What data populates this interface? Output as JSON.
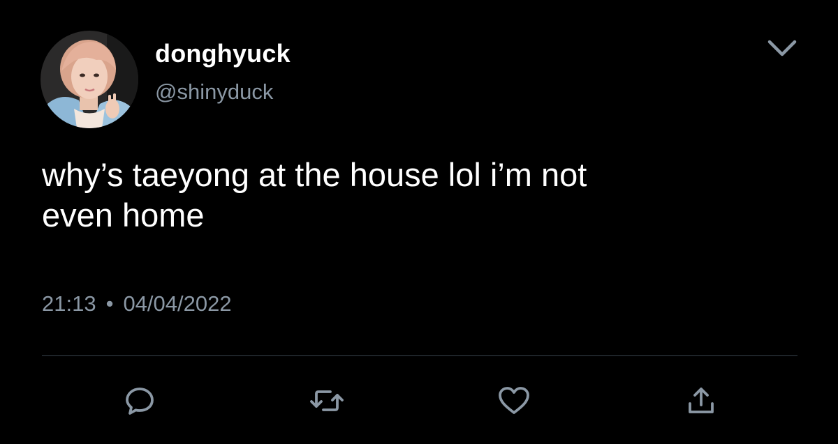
{
  "user": {
    "display_name": "donghyuck",
    "handle": "@shinyduck",
    "avatar_icon": "profile-photo"
  },
  "tweet": {
    "text": "why’s taeyong at the house lol i’m not\neven home",
    "time": "21:13",
    "separator": "•",
    "date": "04/04/2022"
  },
  "actions": {
    "reply_icon": "reply-icon",
    "retweet_icon": "retweet-icon",
    "like_icon": "heart-icon",
    "share_icon": "share-icon"
  },
  "colors": {
    "background": "#000000",
    "text_primary": "#ffffff",
    "text_secondary": "#8b98a5",
    "divider": "#38444d",
    "icon": "#8b98a5"
  }
}
